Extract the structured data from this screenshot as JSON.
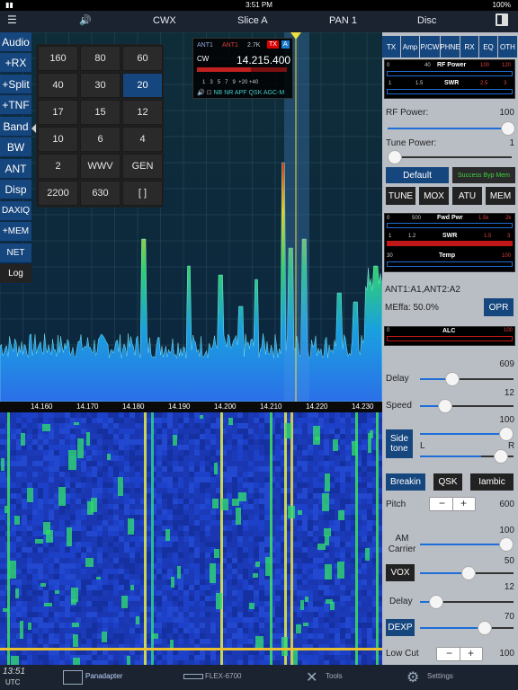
{
  "status": {
    "left": "▮▮",
    "time": "3:51 PM",
    "battery": "100%"
  },
  "topbar": {
    "items": [
      "CWX",
      "Slice A",
      "PAN 1",
      "Disc"
    ]
  },
  "left_buttons": [
    "Audio",
    "+RX",
    "+Split",
    "+TNF",
    "Band",
    "BW",
    "ANT",
    "Disp",
    "DAXIQ",
    "+MEM",
    "NET",
    "Log"
  ],
  "band_panel": {
    "buttons": [
      "160",
      "80",
      "60",
      "40",
      "30",
      "20",
      "17",
      "15",
      "12",
      "10",
      "6",
      "4",
      "2",
      "WWV",
      "GEN",
      "2200",
      "630",
      "[ ]"
    ],
    "selected": "20"
  },
  "slice": {
    "ant1": "ANT1",
    "ant2": "ANT1",
    "bw": "2.7K",
    "tx": "TX",
    "letter": "A",
    "mode": "CW",
    "freq": "14.215.400",
    "scale": [
      "1",
      "3",
      "5",
      "7",
      "9",
      "+20",
      "+40"
    ],
    "flags": [
      "NB",
      "NR",
      "APF",
      "QSK",
      "AGC-M"
    ]
  },
  "freq_axis": [
    "14.160",
    "14.170",
    "14.180",
    "14.190",
    "14.200",
    "14.210",
    "14.220",
    "14.230"
  ],
  "right": {
    "tabs": [
      "TX",
      "Amp",
      "P/CW",
      "PHNE",
      "RX",
      "EQ",
      "OTH"
    ],
    "meter1": {
      "title": "RF Power",
      "scale": [
        "0",
        "40",
        "80",
        "100",
        "120"
      ]
    },
    "meter2": {
      "title": "SWR",
      "scale": [
        "1",
        "1.5",
        "2.5",
        "3"
      ]
    },
    "rf_power": {
      "label": "RF Power:",
      "value": "100",
      "level": 1.0
    },
    "tune_power": {
      "label": "Tune Power:",
      "value": "1",
      "level": 0.02
    },
    "profile": {
      "default": "Default",
      "status": "Success Byp Mem"
    },
    "buttons": [
      "TUNE",
      "MOX",
      "ATU",
      "MEM"
    ],
    "meter3": {
      "title": "Fwd Pwr",
      "scale": [
        "0",
        "500",
        "1.5k",
        "2k"
      ]
    },
    "meter4": {
      "title": "SWR",
      "scale": [
        "1",
        "1.2",
        "1.5",
        "3"
      ]
    },
    "meter5": {
      "title": "Temp",
      "scale": [
        "30",
        "100"
      ]
    },
    "ant_info": "ANT1:A1,ANT2:A2",
    "meffa": "MEffa: 50.0%",
    "opr": "OPR",
    "alc": {
      "title": "ALC",
      "scale": [
        "0",
        "100"
      ]
    },
    "delay": {
      "label": "Delay",
      "value": "609",
      "level": 0.35
    },
    "speed": {
      "label": "Speed",
      "value": "12",
      "level": 0.28
    },
    "sidetone": {
      "label1": "Side",
      "label2": "tone",
      "value": "100",
      "level": 1.0,
      "l": "L",
      "r": "R",
      "pan_level": 0.65
    },
    "cw_buttons": [
      "Breakin",
      "QSK",
      "Iambic"
    ],
    "pitch": {
      "label": "Pitch",
      "value": "600"
    },
    "am_carrier": {
      "label1": "AM",
      "label2": "Carrier",
      "value": "100",
      "level": 1.0
    },
    "vox": {
      "label": "VOX",
      "value": "50",
      "level": 0.6
    },
    "vox_delay": {
      "label": "Delay",
      "value": "12",
      "level": 0.15
    },
    "dexp": {
      "label": "DEXP",
      "value": "70",
      "level": 0.75
    },
    "lowcut": {
      "label": "Low Cut",
      "value": "100"
    }
  },
  "bottom": {
    "time": "13:51",
    "utc": "UTC",
    "tabs": [
      "Panadapter",
      "FLEX-6700",
      "Tools",
      "Settings"
    ]
  }
}
